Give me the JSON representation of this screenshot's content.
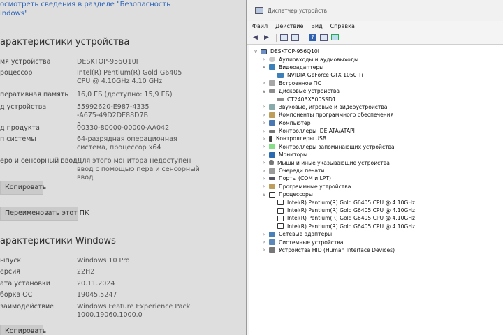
{
  "settings": {
    "top_link_line1": "осмотреть сведения в разделе \"Безопасность",
    "top_link_line2": "indows\"",
    "device_section_title": "арактеристики устройства",
    "device_specs": [
      {
        "label": "мя устройства",
        "value": "DESKTOP-956Q10I"
      },
      {
        "label": "роцессор",
        "value": "Intel(R) Pentium(R) Gold G6405 CPU @ 4.10GHz   4.10 GHz"
      },
      {
        "label": "перативная память",
        "value": "16,0 ГБ (доступно: 15,9 ГБ)"
      },
      {
        "label": "д устройства",
        "value": "55992620-E987-4335-A675-49D2DE88D7B5"
      },
      {
        "label": "д продукта",
        "value": "00330-80000-00000-AA042"
      },
      {
        "label": "п системы",
        "value": "64-разрядная операционная система, процессор x64"
      },
      {
        "label": "еро и сенсорный ввод",
        "value": "Для этого монитора недоступен ввод с помощью пера и сенсорный ввод"
      }
    ],
    "copy_button_1": "Копировать",
    "rename_button": "Переименовать этот ПК",
    "windows_section_title": "арактеристики Windows",
    "windows_specs": [
      {
        "label": "ыпуск",
        "value": "Windows 10 Pro"
      },
      {
        "label": "ерсия",
        "value": "22H2"
      },
      {
        "label": "ата установки",
        "value": "20.11.2024"
      },
      {
        "label": "борка ОС",
        "value": "19045.5247"
      },
      {
        "label": "заимодействие",
        "value": "Windows Feature Experience Pack 1000.19060.1000.0"
      }
    ],
    "copy_button_2": "Копировать"
  },
  "device_manager": {
    "title": "Диспетчер устройств",
    "menu": [
      "Файл",
      "Действие",
      "Вид",
      "Справка"
    ],
    "tree": [
      {
        "label": "DESKTOP-956Q10I",
        "level": 0,
        "expander": "open",
        "icon": "computer-root-icon"
      },
      {
        "label": "Аудиовходы и аудиовыходы",
        "level": 1,
        "expander": "closed",
        "icon": "audio-icon"
      },
      {
        "label": "Видеоадаптеры",
        "level": 1,
        "expander": "open",
        "icon": "display-adapter-icon"
      },
      {
        "label": "NVIDIA GeForce GTX 1050 Ti",
        "level": 2,
        "expander": "",
        "icon": "display-adapter-icon"
      },
      {
        "label": "Встроенное ПО",
        "level": 1,
        "expander": "closed",
        "icon": "firmware-icon"
      },
      {
        "label": "Дисковые устройства",
        "level": 1,
        "expander": "open",
        "icon": "disk-icon"
      },
      {
        "label": "CT240BX500SSD1",
        "level": 2,
        "expander": "",
        "icon": "disk-icon"
      },
      {
        "label": "Звуковые, игровые и видеоустройства",
        "level": 1,
        "expander": "closed",
        "icon": "sound-icon"
      },
      {
        "label": "Компоненты программного обеспечения",
        "level": 1,
        "expander": "closed",
        "icon": "software-component-icon"
      },
      {
        "label": "Компьютер",
        "level": 1,
        "expander": "closed",
        "icon": "computer-icon"
      },
      {
        "label": "Контроллеры IDE ATA/ATAPI",
        "level": 1,
        "expander": "closed",
        "icon": "ide-controller-icon"
      },
      {
        "label": "Контроллеры USB",
        "level": 1,
        "expander": "closed",
        "icon": "usb-icon"
      },
      {
        "label": "Контроллеры запоминающих устройства",
        "level": 1,
        "expander": "closed",
        "icon": "storage-controller-icon"
      },
      {
        "label": "Мониторы",
        "level": 1,
        "expander": "closed",
        "icon": "monitor-icon"
      },
      {
        "label": "Мыши и иные указывающие устройства",
        "level": 1,
        "expander": "closed",
        "icon": "mouse-icon"
      },
      {
        "label": "Очереди печати",
        "level": 1,
        "expander": "closed",
        "icon": "print-queue-icon"
      },
      {
        "label": "Порты (COM и LPT)",
        "level": 1,
        "expander": "closed",
        "icon": "port-icon"
      },
      {
        "label": "Программные устройства",
        "level": 1,
        "expander": "closed",
        "icon": "software-device-icon"
      },
      {
        "label": "Процессоры",
        "level": 1,
        "expander": "open",
        "icon": "processor-icon"
      },
      {
        "label": "Intel(R) Pentium(R) Gold G6405 CPU @ 4.10GHz",
        "level": 2,
        "expander": "",
        "icon": "processor-icon"
      },
      {
        "label": "Intel(R) Pentium(R) Gold G6405 CPU @ 4.10GHz",
        "level": 2,
        "expander": "",
        "icon": "processor-icon"
      },
      {
        "label": "Intel(R) Pentium(R) Gold G6405 CPU @ 4.10GHz",
        "level": 2,
        "expander": "",
        "icon": "processor-icon"
      },
      {
        "label": "Intel(R) Pentium(R) Gold G6405 CPU @ 4.10GHz",
        "level": 2,
        "expander": "",
        "icon": "processor-icon"
      },
      {
        "label": "Сетевые адаптеры",
        "level": 1,
        "expander": "closed",
        "icon": "network-adapter-icon"
      },
      {
        "label": "Системные устройства",
        "level": 1,
        "expander": "closed",
        "icon": "system-device-icon"
      },
      {
        "label": "Устройства HID (Human Interface Devices)",
        "level": 1,
        "expander": "closed",
        "icon": "hid-icon"
      }
    ]
  }
}
